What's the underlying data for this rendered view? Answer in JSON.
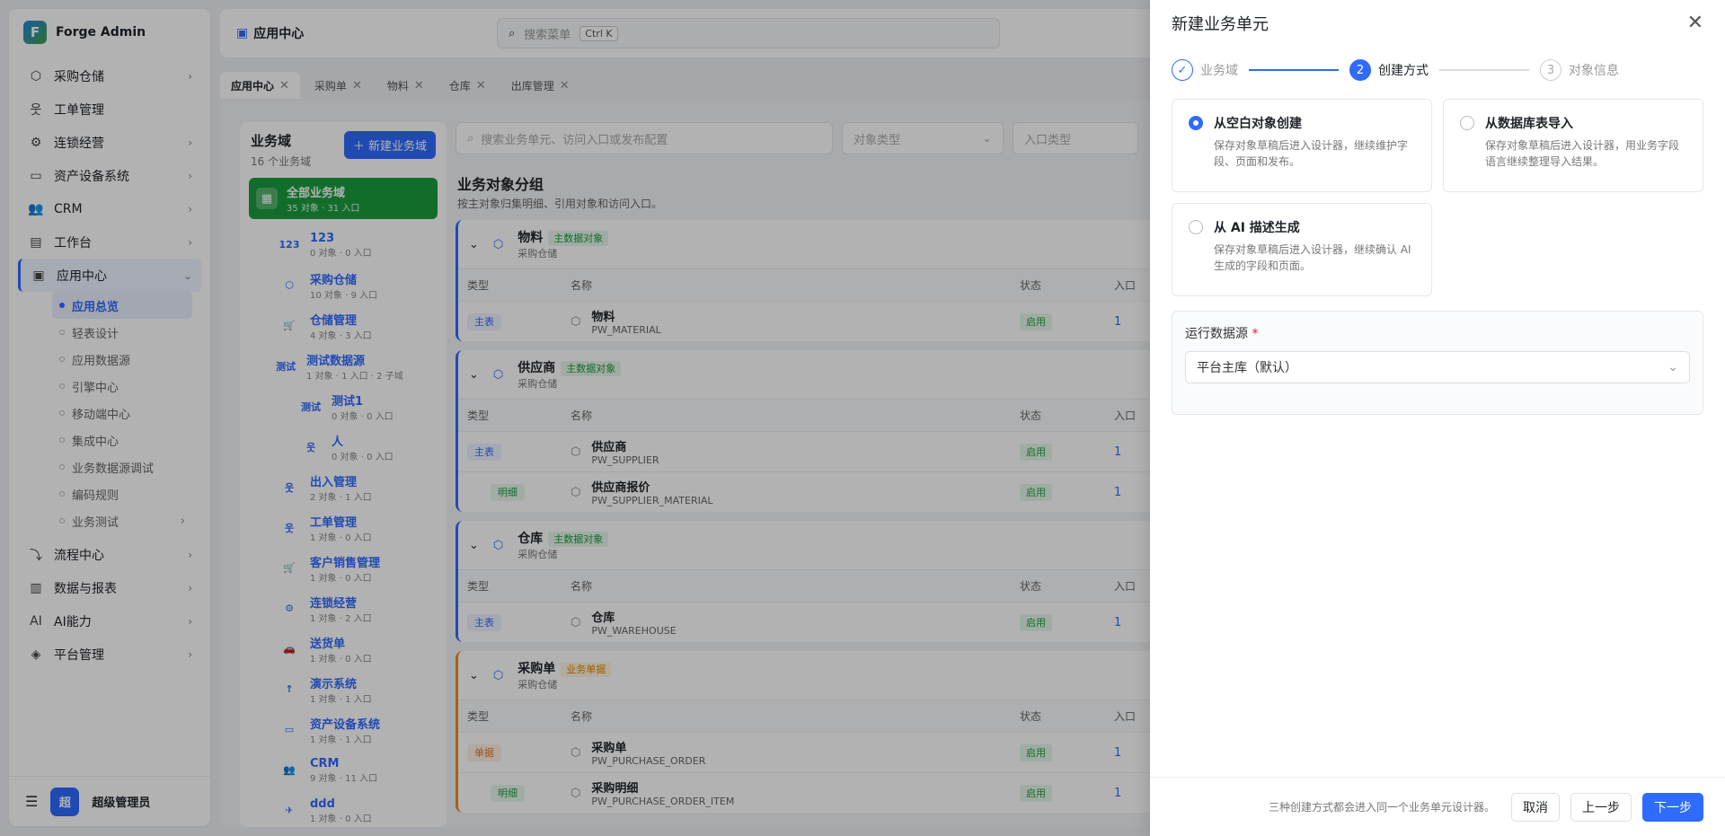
{
  "app": {
    "name": "Forge Admin",
    "logo": "F"
  },
  "sidebar": {
    "items": [
      {
        "label": "采购仓储",
        "icon": "box-icon",
        "chev": "›"
      },
      {
        "label": "工单管理",
        "icon": "person-icon",
        "chev": ""
      },
      {
        "label": "连锁经营",
        "icon": "gear-icon",
        "chev": "›"
      },
      {
        "label": "资产设备系统",
        "icon": "monitor-icon",
        "chev": "›"
      },
      {
        "label": "CRM",
        "icon": "users-icon",
        "chev": "›"
      },
      {
        "label": "工作台",
        "icon": "clipboard-icon",
        "chev": "›"
      },
      {
        "label": "应用中心",
        "icon": "app-icon",
        "chev": "⌄"
      }
    ],
    "sub": [
      "应用总览",
      "轻表设计",
      "应用数据源",
      "引擎中心",
      "移动端中心",
      "集成中心",
      "业务数据源调试",
      "编码规则",
      "业务测试"
    ],
    "items2": [
      {
        "label": "流程中心",
        "icon": "flow-icon",
        "chev": "›"
      },
      {
        "label": "数据与报表",
        "icon": "report-icon",
        "chev": "›"
      },
      {
        "label": "AI能力",
        "icon": "ai-icon",
        "chev": "›"
      },
      {
        "label": "平台管理",
        "icon": "platform-icon",
        "chev": "›"
      }
    ],
    "user": {
      "avatar": "超",
      "name": "超级管理员"
    }
  },
  "header": {
    "title": "应用中心",
    "search_placeholder": "搜索菜单",
    "shortcut": "Ctrl K"
  },
  "tabs": [
    "应用中心",
    "采购单",
    "物料",
    "仓库",
    "出库管理"
  ],
  "domains": {
    "title": "业务域",
    "count": "16 个业务域",
    "new_label": "＋ 新建业务域",
    "all": {
      "name": "全部业务域",
      "stat": "35 对象 · 31 入口"
    },
    "list": [
      {
        "icon": "123",
        "name": "123",
        "stat": "0 对象 · 0 入口"
      },
      {
        "icon": "⬡",
        "name": "采购仓储",
        "stat": "10 对象 · 9 入口"
      },
      {
        "icon": "🛒",
        "name": "仓储管理",
        "stat": "4 对象 · 3 入口"
      },
      {
        "icon": "测试",
        "name": "测试数据源",
        "stat": "1 对象 · 1 入口 · 2 子域"
      },
      {
        "icon": "测试",
        "name": "测试1",
        "stat": "0 对象 · 0 入口"
      },
      {
        "icon": "웃",
        "name": "人",
        "stat": "0 对象 · 0 入口"
      },
      {
        "icon": "웃",
        "name": "出入管理",
        "stat": "2 对象 · 1 入口"
      },
      {
        "icon": "웃",
        "name": "工单管理",
        "stat": "1 对象 · 0 入口"
      },
      {
        "icon": "🛒",
        "name": "客户销售管理",
        "stat": "1 对象 · 0 入口"
      },
      {
        "icon": "⚙",
        "name": "连锁经营",
        "stat": "1 对象 · 2 入口"
      },
      {
        "icon": "🚗",
        "name": "送货单",
        "stat": "1 对象 · 0 入口"
      },
      {
        "icon": "↑",
        "name": "演示系统",
        "stat": "1 对象 · 1 入口"
      },
      {
        "icon": "▭",
        "name": "资产设备系统",
        "stat": "1 对象 · 1 入口"
      },
      {
        "icon": "👥",
        "name": "CRM",
        "stat": "9 对象 · 11 入口"
      },
      {
        "icon": "✈",
        "name": "ddd",
        "stat": "1 对象 · 0 入口"
      }
    ]
  },
  "objects": {
    "search_placeholder": "搜索业务单元、访问入口或发布配置",
    "type_placeholder": "对象类型",
    "entry_placeholder": "入口类型",
    "title": "业务对象分组",
    "subtitle": "按主对象归集明细、引用对象和访问入口。",
    "cols": [
      "类型",
      "名称",
      "状态",
      "入口"
    ],
    "groups": [
      {
        "name": "物料",
        "tag": "主数据对象",
        "domain": "采购仓储",
        "rows": [
          {
            "type": "主表",
            "name": "物料",
            "code": "PW_MATERIAL",
            "status": "启用",
            "entry": "1"
          }
        ]
      },
      {
        "name": "供应商",
        "tag": "主数据对象",
        "domain": "采购仓储",
        "rows": [
          {
            "type": "主表",
            "name": "供应商",
            "code": "PW_SUPPLIER",
            "status": "启用",
            "entry": "1"
          },
          {
            "type": "明细",
            "name": "供应商报价",
            "code": "PW_SUPPLIER_MATERIAL",
            "status": "启用",
            "entry": "1"
          }
        ]
      },
      {
        "name": "仓库",
        "tag": "主数据对象",
        "domain": "采购仓储",
        "rows": [
          {
            "type": "主表",
            "name": "仓库",
            "code": "PW_WAREHOUSE",
            "status": "启用",
            "entry": "1"
          }
        ]
      },
      {
        "name": "采购单",
        "tag": "业务单据",
        "domain": "采购仓储",
        "rows": [
          {
            "type": "单据",
            "name": "采购单",
            "code": "PW_PURCHASE_ORDER",
            "status": "启用",
            "entry": "1"
          },
          {
            "type": "明细",
            "name": "采购明细",
            "code": "PW_PURCHASE_ORDER_ITEM",
            "status": "启用",
            "entry": "1"
          }
        ]
      }
    ]
  },
  "drawer": {
    "title": "新建业务单元",
    "steps": [
      {
        "num": "✓",
        "label": "业务域"
      },
      {
        "num": "2",
        "label": "创建方式"
      },
      {
        "num": "3",
        "label": "对象信息"
      }
    ],
    "options": [
      {
        "title": "从空白对象创建",
        "desc": "保存对象草稿后进入设计器，继续维护字段、页面和发布。",
        "selected": true
      },
      {
        "title": "从数据库表导入",
        "desc": "保存对象草稿后进入设计器，用业务字段语言继续整理导入结果。",
        "selected": false
      },
      {
        "title": "从 AI 描述生成",
        "desc": "保存对象草稿后进入设计器，继续确认 AI 生成的字段和页面。",
        "selected": false
      }
    ],
    "datasource_label": "运行数据源",
    "datasource_value": "平台主库（默认）",
    "hint": "三种创建方式都会进入同一个业务单元设计器。",
    "cancel": "取消",
    "prev": "上一步",
    "next": "下一步"
  }
}
